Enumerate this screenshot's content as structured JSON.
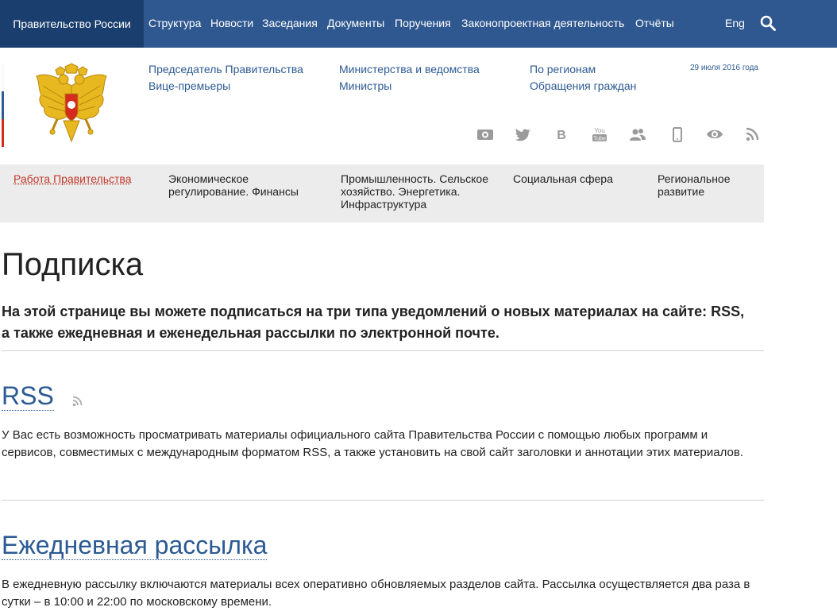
{
  "topbar": {
    "brand": "Правительство России",
    "nav": [
      {
        "id": "structure",
        "label": "Структура"
      },
      {
        "id": "news",
        "label": "Новости"
      },
      {
        "id": "meetings",
        "label": "Заседания"
      },
      {
        "id": "documents",
        "label": "Документы"
      },
      {
        "id": "orders",
        "label": "Поручения"
      },
      {
        "id": "lawmaking",
        "label": "Законопроектная деятельность"
      },
      {
        "id": "reports",
        "label": "Отчёты"
      }
    ],
    "lang": "Eng",
    "search_icon": "search-icon"
  },
  "header": {
    "links": {
      "chairman": "Председатель Правительства",
      "vice_premiers": "Вице-премьеры",
      "ministries": "Министерства и ведомства",
      "ministers": "Министры",
      "regions": "По регионам",
      "appeals": "Обращения граждан"
    },
    "date": "29 июля 2016 года",
    "social_icons": [
      "video-icon",
      "twitter-icon",
      "vk-icon",
      "youtube-icon",
      "people-icon",
      "mobile-icon",
      "eye-icon",
      "rss-icon"
    ],
    "youtube_text": {
      "top": "You",
      "bottom": "Tube"
    },
    "vk_letter": "B"
  },
  "sections": [
    {
      "id": "gov-work",
      "label": "Работа Правительства",
      "active": true
    },
    {
      "id": "economy",
      "label": "Экономическое регулирование. Финансы"
    },
    {
      "id": "industry",
      "label": "Промышленность. Сельское хозяйство. Энергетика. Инфраструктура"
    },
    {
      "id": "social",
      "label": "Социальная сфера"
    },
    {
      "id": "regional",
      "label": "Региональное развитие"
    }
  ],
  "content": {
    "title": "Подписка",
    "lead": "На этой странице вы можете подписаться на три типа уведомлений о новых материалах на сайте: RSS, а также ежедневная и еженедельная рассылки по электронной почте.",
    "rss_title": "RSS",
    "rss_text": "У Вас есть возможность просматривать материалы официального сайта Правительства России с помощью любых программ и сервисов, совместимых с международным форматом RSS, а также установить на свой сайт заголовки и аннотации этих материалов.",
    "daily_title": "Ежедневная рассылка",
    "daily_text": "В ежедневную рассылку включаются материалы всех оперативно обновляемых разделов сайта. Рассылка осуществляется два раза в сутки – в 10:00 и 22:00 по московскому времени."
  },
  "colors": {
    "topbar": "#2f5890",
    "brand_bg": "#1a3e6e",
    "link": "#2c5a94",
    "active_section": "#c0392b",
    "section_bg": "#ececec",
    "icon_gray": "#9a9a9a"
  }
}
